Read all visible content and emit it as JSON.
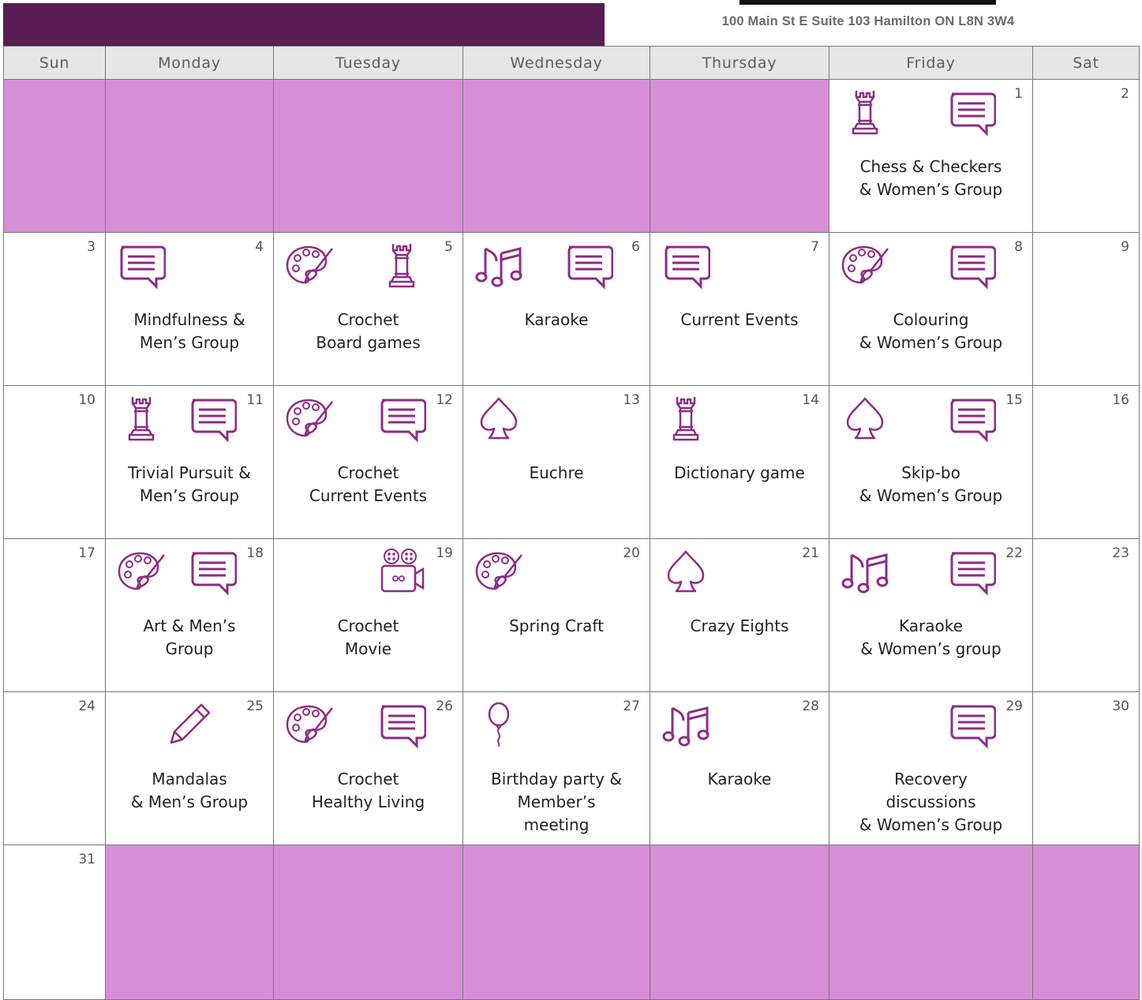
{
  "header": {
    "address": "100 Main St E Suite 103 Hamilton ON L8N 3W4"
  },
  "days": [
    "Sun",
    "Monday",
    "Tuesday",
    "Wednesday",
    "Thursday",
    "Friday",
    "Sat"
  ],
  "colors": {
    "banner": "#581d52",
    "empty_cell": "#d68fd6",
    "icon": "#8e2b86",
    "header_bg": "#e6e6e6"
  },
  "weeks": [
    [
      {
        "empty": true
      },
      {
        "empty": true
      },
      {
        "empty": true
      },
      {
        "empty": true
      },
      {
        "empty": true
      },
      {
        "day": "1",
        "icons": [
          "chess-rook-icon",
          "speech-bubble-icon"
        ],
        "lines": [
          "Chess & Checkers",
          "& Women’s Group"
        ]
      },
      {
        "day": "2"
      }
    ],
    [
      {
        "day": "3"
      },
      {
        "day": "4",
        "icons": [
          "speech-bubble-icon"
        ],
        "lines": [
          "Mindfulness &",
          "Men’s Group"
        ]
      },
      {
        "day": "5",
        "icons": [
          "paint-palette-icon",
          "chess-rook-icon"
        ],
        "lines": [
          "Crochet",
          "Board games"
        ]
      },
      {
        "day": "6",
        "icons": [
          "music-notes-icon",
          "speech-bubble-icon"
        ],
        "lines": [
          "Karaoke"
        ]
      },
      {
        "day": "7",
        "icons": [
          "speech-bubble-icon"
        ],
        "lines": [
          "Current Events"
        ]
      },
      {
        "day": "8",
        "icons": [
          "paint-palette-icon",
          "speech-bubble-icon"
        ],
        "lines": [
          "Colouring",
          "& Women’s Group"
        ]
      },
      {
        "day": "9"
      }
    ],
    [
      {
        "day": "10"
      },
      {
        "day": "11",
        "icons": [
          "chess-rook-icon",
          "speech-bubble-icon"
        ],
        "lines": [
          "Trivial Pursuit &",
          "Men’s Group"
        ]
      },
      {
        "day": "12",
        "icons": [
          "paint-palette-icon",
          "speech-bubble-icon"
        ],
        "lines": [
          "Crochet",
          "Current Events"
        ]
      },
      {
        "day": "13",
        "icons": [
          "spade-icon"
        ],
        "lines": [
          "Euchre"
        ]
      },
      {
        "day": "14",
        "icons": [
          "chess-rook-icon"
        ],
        "lines": [
          "Dictionary game"
        ]
      },
      {
        "day": "15",
        "icons": [
          "spade-icon",
          "speech-bubble-icon"
        ],
        "lines": [
          "Skip-bo",
          "& Women’s Group"
        ]
      },
      {
        "day": "16"
      }
    ],
    [
      {
        "day": "17"
      },
      {
        "day": "18",
        "icons": [
          "paint-palette-icon",
          "speech-bubble-icon"
        ],
        "lines": [
          "Art & Men’s",
          "Group"
        ]
      },
      {
        "day": "19",
        "icons": [
          "movie-camera-icon"
        ],
        "lines": [
          "Crochet",
          "Movie"
        ]
      },
      {
        "day": "20",
        "icons": [
          "paint-palette-icon"
        ],
        "lines": [
          "Spring Craft"
        ]
      },
      {
        "day": "21",
        "icons": [
          "spade-icon"
        ],
        "lines": [
          "Crazy Eights"
        ]
      },
      {
        "day": "22",
        "icons": [
          "music-notes-icon",
          "speech-bubble-icon"
        ],
        "lines": [
          "Karaoke",
          "& Women’s group"
        ]
      },
      {
        "day": "23"
      }
    ],
    [
      {
        "day": "24"
      },
      {
        "day": "25",
        "icons": [
          "pencil-icon"
        ],
        "lines": [
          "Mandalas",
          "& Men’s Group"
        ]
      },
      {
        "day": "26",
        "icons": [
          "paint-palette-icon",
          "speech-bubble-icon"
        ],
        "lines": [
          "Crochet",
          "Healthy Living"
        ]
      },
      {
        "day": "27",
        "icons": [
          "balloon-icon"
        ],
        "lines": [
          "Birthday party &",
          "Member’s",
          "meeting"
        ]
      },
      {
        "day": "28",
        "icons": [
          "music-notes-icon"
        ],
        "lines": [
          "Karaoke"
        ]
      },
      {
        "day": "29",
        "icons": [
          "speech-bubble-icon"
        ],
        "lines": [
          "Recovery",
          "discussions",
          "& Women’s Group"
        ]
      },
      {
        "day": "30"
      }
    ],
    [
      {
        "day": "31"
      },
      {
        "empty": true
      },
      {
        "empty": true
      },
      {
        "empty": true
      },
      {
        "empty": true
      },
      {
        "empty": true
      },
      {
        "empty": true
      }
    ]
  ]
}
